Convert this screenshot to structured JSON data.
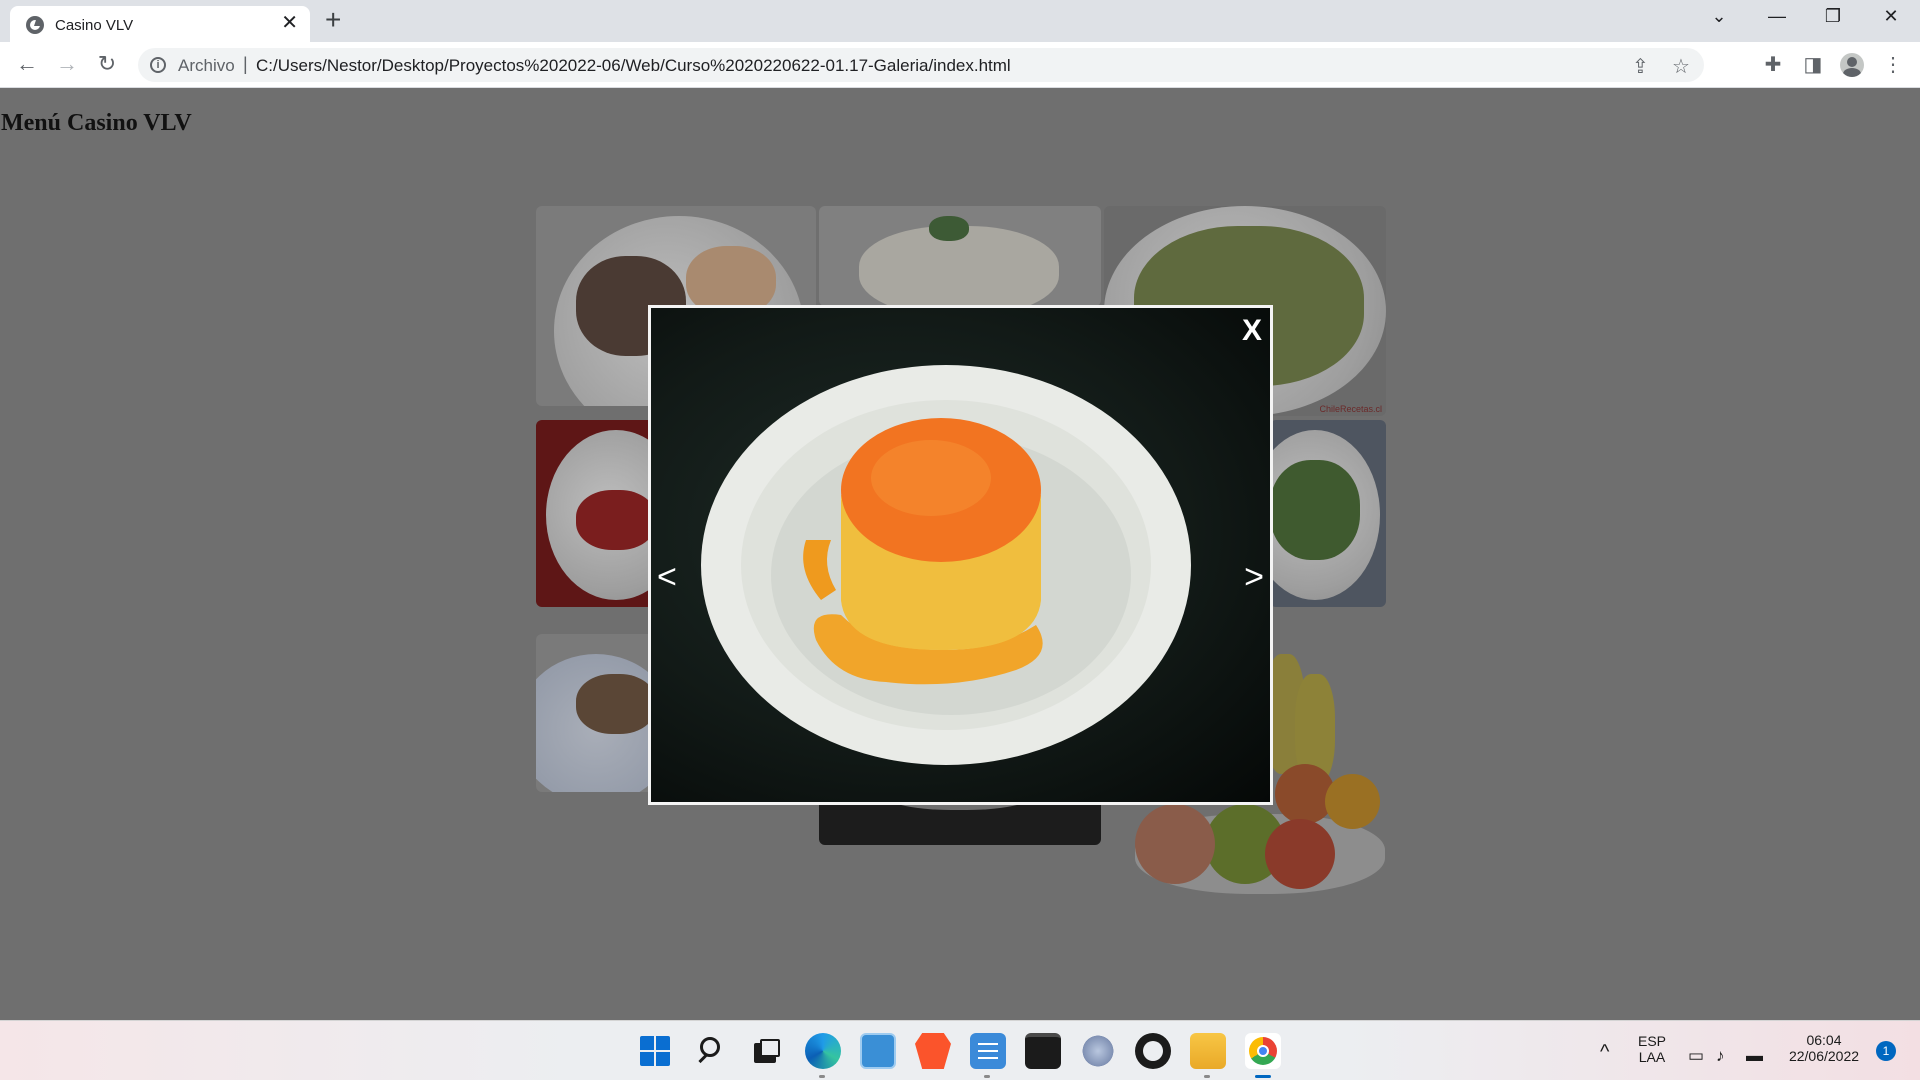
{
  "browser": {
    "tab": {
      "title": "Casino VLV",
      "close_glyph": "✕"
    },
    "new_tab_glyph": "+",
    "window_controls": {
      "list": "⌄",
      "minimize": "—",
      "restore": "❐",
      "close": "✕"
    },
    "nav": {
      "back": "←",
      "forward": "→",
      "reload": "↻"
    },
    "omnibox": {
      "security_label": "Archivo",
      "url": "C:/Users/Nestor/Desktop/Proyectos%202022-06/Web/Curso%2020220622-01.17-Galeria/index.html"
    },
    "icons": {
      "share": "⇪",
      "bookmark": "☆",
      "extensions": "✚",
      "sidepanel": "◨",
      "menu": "⋮"
    }
  },
  "page": {
    "title": "Menú Casino VLV"
  },
  "gallery": {
    "items": [
      "steak-plate",
      "rice-plate",
      "vegetable-rice-bowl",
      "tomato-salad",
      "green-beans-plate",
      "fish-plate",
      "dark-dish",
      "fruit-bowl"
    ],
    "watermark": "ChileRecetas.cl"
  },
  "lightbox": {
    "close_label": "X",
    "prev_label": "<",
    "next_label": ">",
    "image_subject": "flan-dessert"
  },
  "taskbar": {
    "apps": [
      "start-icon",
      "search-icon",
      "task-view-icon",
      "edge-icon",
      "control-panel-icon",
      "brave-icon",
      "notepad-icon",
      "terminal-icon",
      "xampp-icon",
      "nodejs-icon",
      "file-explorer-icon",
      "chrome-icon"
    ],
    "language": {
      "line1": "ESP",
      "line2": "LAA"
    },
    "time": "06:04",
    "date": "22/06/2022",
    "notifications": "1",
    "tray_chevron": "^"
  },
  "colors": {
    "overlay_bg": "#6f6f6f",
    "chrome_tab_strip": "#dee1e6",
    "accent": "#0067c0"
  }
}
